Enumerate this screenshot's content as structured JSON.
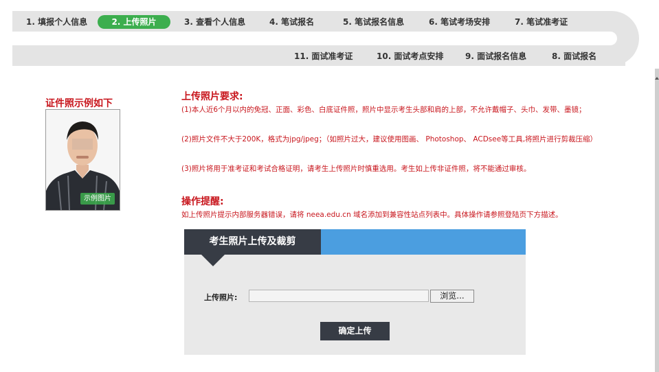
{
  "steps": {
    "row1": [
      {
        "label": "1. 填报个人信息",
        "active": false
      },
      {
        "label": "2. 上传照片",
        "active": true
      },
      {
        "label": "3. 查看个人信息",
        "active": false
      },
      {
        "label": "4. 笔试报名",
        "active": false
      },
      {
        "label": "5. 笔试报名信息",
        "active": false
      },
      {
        "label": "6. 笔试考场安排",
        "active": false
      },
      {
        "label": "7. 笔试准考证",
        "active": false
      }
    ],
    "row2": [
      {
        "label": "11. 面试准考证"
      },
      {
        "label": "10. 面试考点安排"
      },
      {
        "label": "9. 面试报名信息"
      },
      {
        "label": "8. 面试报名"
      }
    ],
    "active_color": "#3cae4e"
  },
  "sample": {
    "title": "证件照示例如下",
    "badge": "示例图片"
  },
  "requirements": {
    "title": "上传照片要求:",
    "items": [
      "(1)本人近6个月以内的免冠、正面、彩色、白底证件照，照片中显示考生头部和肩的上部，不允许戴帽子、头巾、发带、墨镜；",
      "(2)照片文件不大于200K，格式为jpg/jpeg；（如照片过大，建议使用图画、 Photoshop、 ACDsee等工具,将照片进行剪裁压缩）",
      "(3)照片将用于准考证和考试合格证明，请考生上传照片时慎重选用。考生如上传非证件照，将不能通过审核。"
    ],
    "color": "#c8161d"
  },
  "operation": {
    "title": "操作提醒:",
    "text": "如上传照片提示内部服务器错误，请将 neea.edu.cn 域名添加到兼容性站点列表中。具体操作请参照登陆页下方描述。"
  },
  "panel": {
    "tab_title": "考生照片上传及裁剪",
    "upload_label": "上传照片:",
    "input_value": "",
    "browse_label": "浏览...",
    "submit_label": "确定上传",
    "header_color": "#4b9ee0",
    "tab_color": "#373c45"
  }
}
